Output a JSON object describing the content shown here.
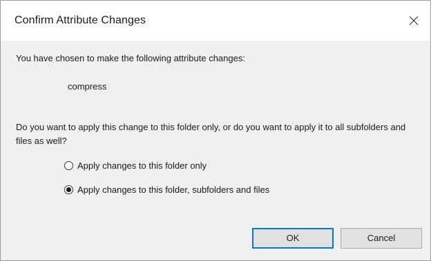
{
  "dialog": {
    "title": "Confirm Attribute Changes",
    "close_icon": "close-icon"
  },
  "body": {
    "intro_text": "You have chosen to make the following attribute changes:",
    "attribute_change": "compress",
    "question": "Do you want to apply this change to this folder only, or do you want to apply it to all subfolders and files as well?"
  },
  "options": [
    {
      "label": "Apply changes to this folder only",
      "selected": false
    },
    {
      "label": "Apply changes to this folder, subfolders and files",
      "selected": true
    }
  ],
  "buttons": {
    "ok_label": "OK",
    "cancel_label": "Cancel"
  },
  "colors": {
    "accent": "#0078d7",
    "content_background": "#f0f0f0",
    "title_background": "#ffffff"
  }
}
